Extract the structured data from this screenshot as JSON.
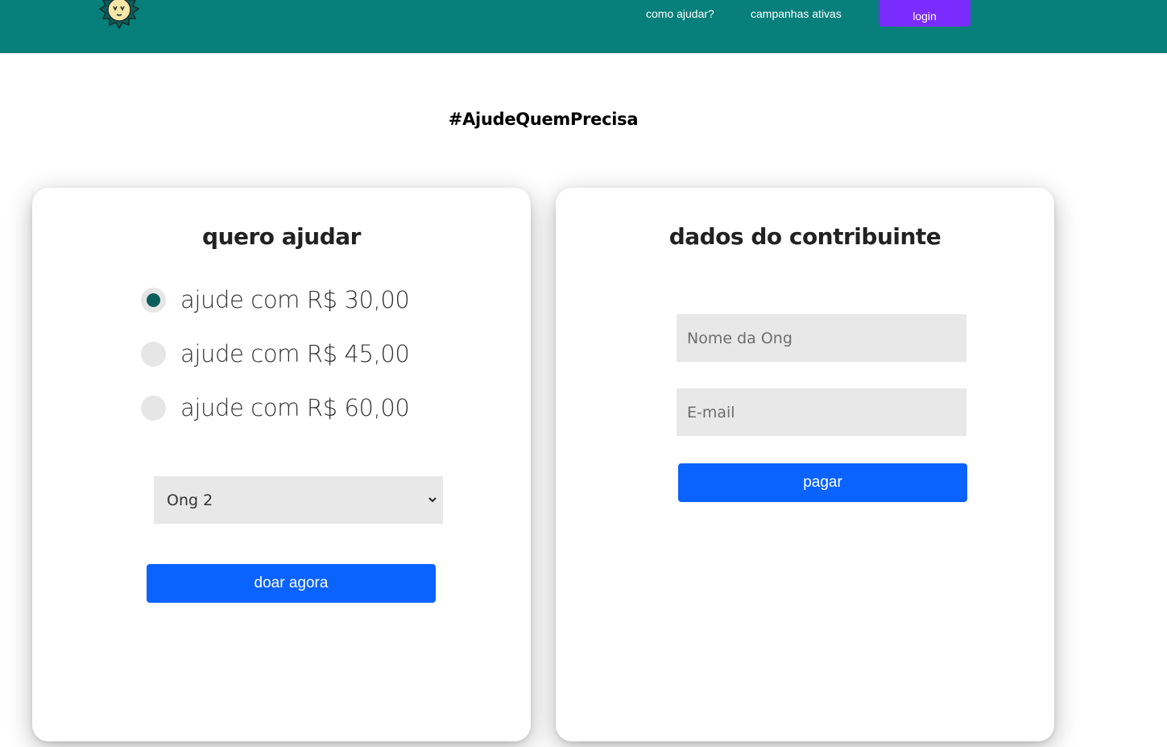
{
  "header": {
    "logo": "sun-mascot-logo",
    "nav": [
      {
        "label": "como ajudar?"
      },
      {
        "label": "campanhas ativas"
      }
    ],
    "login_label": "login",
    "colors": {
      "bar": "#077f7a",
      "login": "#7a2cff"
    }
  },
  "hashtag": "#AjudeQuemPrecisa",
  "donate_card": {
    "title": "quero ajudar",
    "options": [
      {
        "label": "ajude com R$ 30,00",
        "checked": true
      },
      {
        "label": "ajude com R$ 45,00",
        "checked": false
      },
      {
        "label": "ajude com R$ 60,00",
        "checked": false
      }
    ],
    "select": {
      "value": "Ong 2"
    },
    "button_label": "doar agora"
  },
  "contributor_card": {
    "title": "dados do contribuinte",
    "ong_placeholder": "Nome da Ong",
    "email_placeholder": "E-mail",
    "button_label": "pagar"
  },
  "colors": {
    "primary_button": "#0a62ff",
    "radio_checked": "#0b5e5c"
  }
}
